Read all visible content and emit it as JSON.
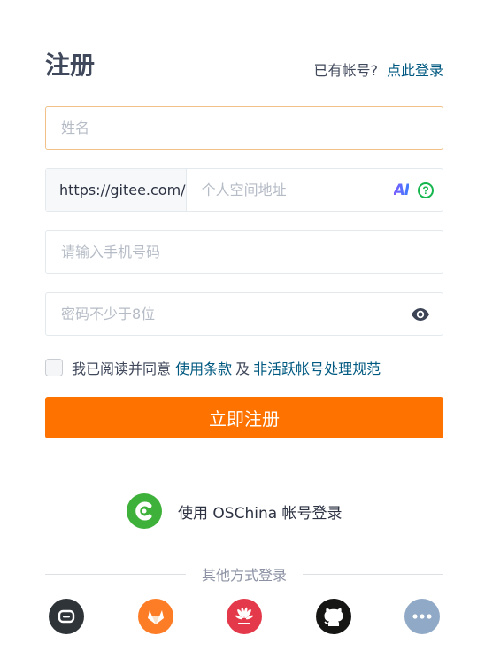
{
  "header": {
    "title": "注册",
    "has_account_text": "已有帐号?",
    "login_link": "点此登录"
  },
  "form": {
    "name_placeholder": "姓名",
    "url_prefix": "https://gitee.com/",
    "space_placeholder": "个人空间地址",
    "ai_label": "AI",
    "help_label": "?",
    "phone_placeholder": "请输入手机号码",
    "password_placeholder": "密码不少于8位",
    "agree_prefix": "我已阅读并同意",
    "terms_link": "使用条款",
    "agree_and": "及",
    "policy_link": "非活跃帐号处理规范",
    "submit_label": "立即注册"
  },
  "oschina": {
    "label": "使用 OSChina 帐号登录"
  },
  "other_login": {
    "label": "其他方式登录",
    "providers": [
      "gitee-link",
      "gitlab",
      "huawei",
      "github",
      "more"
    ]
  },
  "colors": {
    "accent": "#fe7300",
    "link": "#005980",
    "oschina_green": "#3eb13a"
  }
}
